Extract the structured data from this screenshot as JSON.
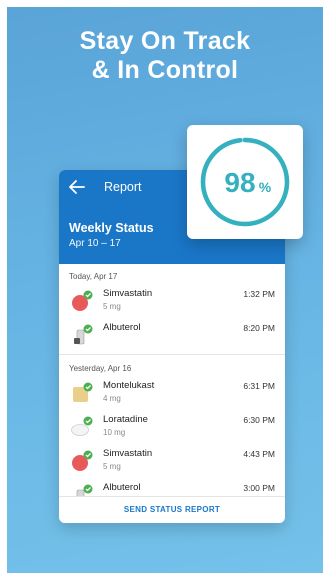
{
  "headline": {
    "line1": "Stay On Track",
    "line2": "& In Control"
  },
  "adherence": {
    "value_label": "98",
    "unit": "%",
    "fraction": 0.98,
    "ring_color": "#34b0bf",
    "ring_track": "#c6e8ee"
  },
  "appbar": {
    "title": "Report"
  },
  "weekly": {
    "title": "Weekly Status",
    "range": "Apr 10 – 17"
  },
  "sections": [
    {
      "label": "Today, Apr 17",
      "items": [
        {
          "name": "Simvastatin",
          "dose": "5 mg",
          "time": "1:32 PM",
          "icon": "red-round-pill-icon"
        },
        {
          "name": "Albuterol",
          "dose": "",
          "time": "8:20 PM",
          "icon": "inhaler-icon"
        }
      ]
    },
    {
      "label": "Yesterday, Apr 16",
      "items": [
        {
          "name": "Montelukast",
          "dose": "4 mg",
          "time": "6:31 PM",
          "icon": "beige-square-pill-icon"
        },
        {
          "name": "Loratadine",
          "dose": "10 mg",
          "time": "6:30 PM",
          "icon": "white-oval-pill-icon"
        },
        {
          "name": "Simvastatin",
          "dose": "5 mg",
          "time": "4:43 PM",
          "icon": "red-round-pill-icon"
        },
        {
          "name": "Albuterol",
          "dose": "",
          "time": "3:00 PM",
          "icon": "inhaler-icon"
        }
      ]
    }
  ],
  "footer": {
    "action": "SEND STATUS REPORT"
  },
  "colors": {
    "primary": "#1a77c8",
    "check": "#4caf50"
  }
}
